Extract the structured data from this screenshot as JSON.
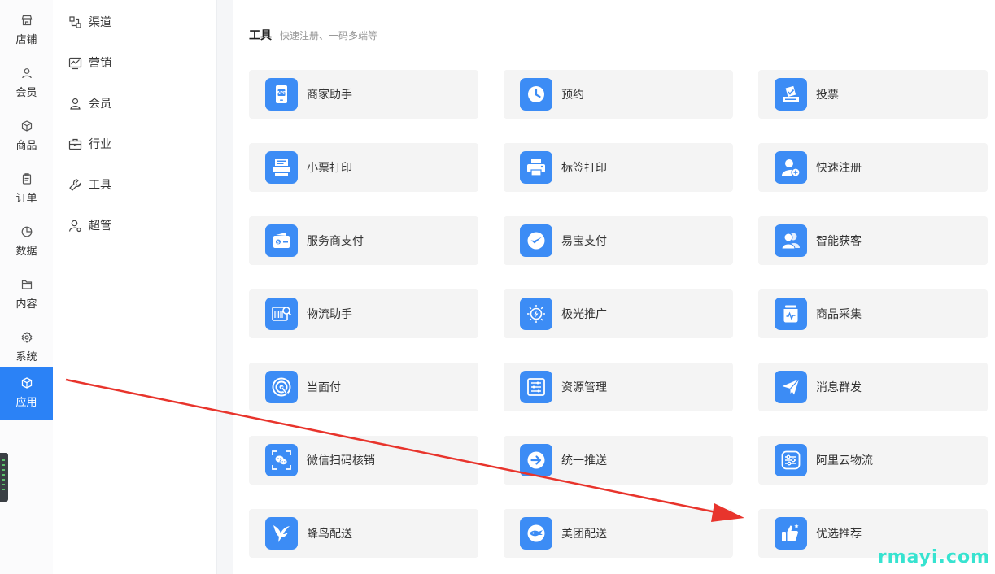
{
  "primary_nav": {
    "items": [
      {
        "label": "店铺",
        "icon": "store-icon"
      },
      {
        "label": "会员",
        "icon": "user-icon"
      },
      {
        "label": "商品",
        "icon": "box-icon"
      },
      {
        "label": "订单",
        "icon": "clipboard-icon"
      },
      {
        "label": "数据",
        "icon": "pie-chart-icon"
      },
      {
        "label": "内容",
        "icon": "folder-icon"
      },
      {
        "label": "系统",
        "icon": "gear-icon"
      },
      {
        "label": "应用",
        "icon": "cube-icon",
        "active": true
      }
    ]
  },
  "secondary_nav": {
    "items": [
      {
        "label": "渠道",
        "icon": "channel-icon"
      },
      {
        "label": "营销",
        "icon": "trend-icon"
      },
      {
        "label": "会员",
        "icon": "user-icon"
      },
      {
        "label": "行业",
        "icon": "briefcase-icon"
      },
      {
        "label": "工具",
        "icon": "wrench-icon"
      },
      {
        "label": "超管",
        "icon": "admin-icon"
      }
    ]
  },
  "section": {
    "title": "工具",
    "subtitle": "快速注册、一码多端等"
  },
  "tools": [
    {
      "label": "商家助手",
      "icon": "app-phone-icon"
    },
    {
      "label": "预约",
      "icon": "clock-icon"
    },
    {
      "label": "投票",
      "icon": "ballot-icon"
    },
    {
      "label": "小票打印",
      "icon": "receipt-printer-icon"
    },
    {
      "label": "标签打印",
      "icon": "label-printer-icon"
    },
    {
      "label": "快速注册",
      "icon": "user-add-icon"
    },
    {
      "label": "服务商支付",
      "icon": "wallet-icon"
    },
    {
      "label": "易宝支付",
      "icon": "check-badge-icon"
    },
    {
      "label": "智能获客",
      "icon": "users-icon"
    },
    {
      "label": "物流助手",
      "icon": "barcode-search-icon"
    },
    {
      "label": "极光推广",
      "icon": "lightning-icon"
    },
    {
      "label": "商品采集",
      "icon": "jar-icon"
    },
    {
      "label": "当面付",
      "icon": "target-icon"
    },
    {
      "label": "资源管理",
      "icon": "list-icon"
    },
    {
      "label": "消息群发",
      "icon": "paper-plane-icon"
    },
    {
      "label": "微信扫码核销",
      "icon": "wechat-scan-icon"
    },
    {
      "label": "统一推送",
      "icon": "arrow-right-circle-icon"
    },
    {
      "label": "阿里云物流",
      "icon": "sliders-icon"
    },
    {
      "label": "蜂鸟配送",
      "icon": "hummingbird-icon"
    },
    {
      "label": "美团配送",
      "icon": "kangaroo-icon"
    },
    {
      "label": "优选推荐",
      "icon": "thumbs-up-icon"
    }
  ],
  "watermark": "rmayi.com",
  "colors": {
    "accent": "#2b82f6",
    "tile": "#3c8cf5",
    "arrow": "#e8342c",
    "watermark": "#37e3d0"
  }
}
